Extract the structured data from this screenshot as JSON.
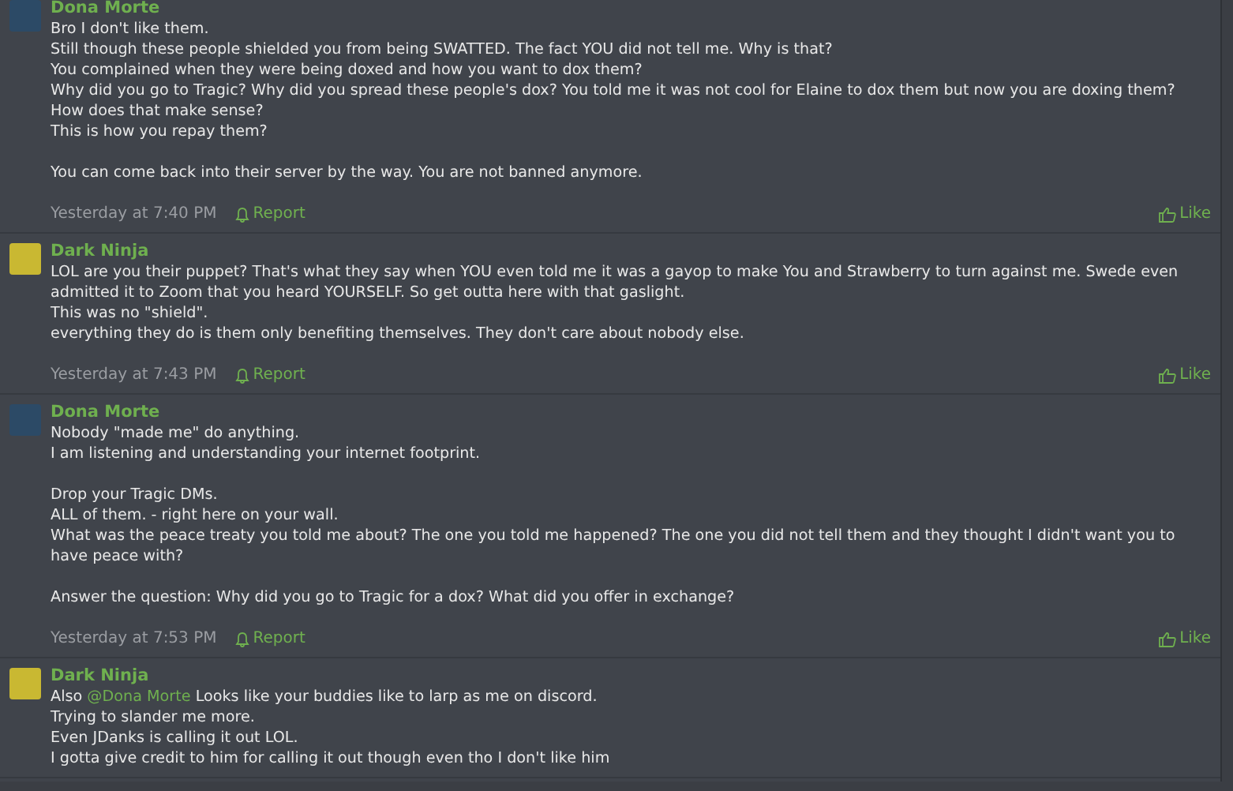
{
  "messages": [
    {
      "author": "Dona Morte",
      "paragraphs": [
        [
          "Bro I don't like them.",
          "Still though these people shielded you from being SWATTED. The fact YOU did not tell me. Why is that?",
          "You complained when they were being doxed and how you want to dox them?",
          "Why did you go to Tragic? Why did you spread these people's dox? You told me it was not cool for Elaine to dox them but now you are doxing them? How does that make sense?",
          "This is how you repay them?"
        ],
        [
          "You can come back into their server by the way. You are not banned anymore."
        ]
      ],
      "time": "Yesterday at 7:40 PM",
      "report": "Report",
      "like": "Like"
    },
    {
      "author": "Dark Ninja",
      "paragraphs": [
        [
          "LOL are you their puppet? That's what they say when YOU even told me it was a gayop to make You and Strawberry to turn against me. Swede even admitted it to Zoom that you heard YOURSELF. So get outta here with that gaslight.",
          "This was no \"shield\".",
          "everything they do is them only benefiting themselves. They don't care about nobody else."
        ]
      ],
      "time": "Yesterday at 7:43 PM",
      "report": "Report",
      "like": "Like"
    },
    {
      "author": "Dona Morte",
      "paragraphs": [
        [
          "Nobody \"made me\" do anything.",
          "I am listening and understanding your internet footprint."
        ],
        [
          "Drop your Tragic DMs.",
          "ALL of them. - right here on your wall.",
          "What was the peace treaty you told me about? The one you told me happened? The one you did not tell them and they thought I didn't want you to have peace with?"
        ],
        [
          "Answer the question: Why did you go to Tragic for a dox? What did you offer in exchange?"
        ]
      ],
      "time": "Yesterday at 7:53 PM",
      "report": "Report",
      "like": "Like"
    },
    {
      "author": "Dark Ninja",
      "paragraphs": [
        [
          {
            "before": "Also ",
            "mention": "@Dona Morte",
            "after": " Looks like your buddies like to larp as me on discord."
          },
          "Trying to slander me more.",
          "Even JDanks is calling it out LOL.",
          "I gotta give credit to him for calling it out though even tho I don't like him"
        ]
      ]
    }
  ]
}
